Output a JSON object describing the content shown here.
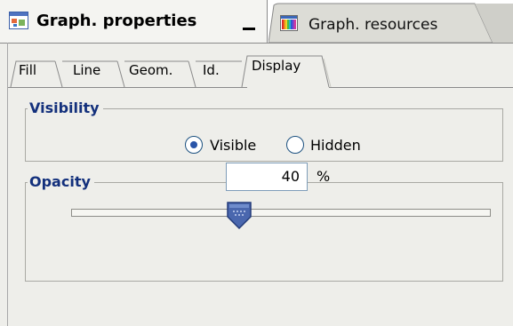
{
  "tabs": {
    "active": {
      "title": "Graph. properties",
      "icon": "graph-properties-icon"
    },
    "inactive": {
      "title": "Graph. resources",
      "icon": "graph-resources-icon"
    }
  },
  "subtabs": [
    {
      "label": "Fill",
      "selected": false
    },
    {
      "label": "Line",
      "selected": false
    },
    {
      "label": "Geom.",
      "selected": false
    },
    {
      "label": "Id.",
      "selected": false
    },
    {
      "label": "Display",
      "selected": true
    }
  ],
  "visibility": {
    "title": "Visibility",
    "options": [
      {
        "label": "Visible",
        "checked": true
      },
      {
        "label": "Hidden",
        "checked": false
      }
    ]
  },
  "opacity": {
    "title": "Opacity",
    "value": "40",
    "unit": "%",
    "slider_fraction": 0.4
  },
  "colors": {
    "accent": "#13307c",
    "panel": "#eeeeea",
    "radio_dot": "#2a55a8",
    "thumb": "#4a67ae"
  }
}
